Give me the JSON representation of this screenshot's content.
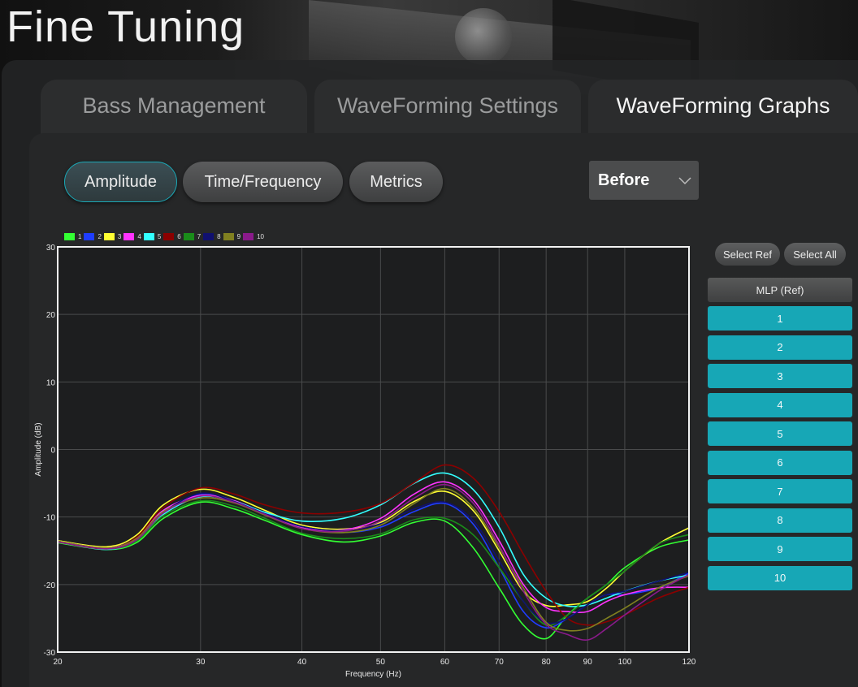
{
  "page_title": "Fine Tuning",
  "tabs": [
    {
      "label": "Bass Management",
      "active": false
    },
    {
      "label": "WaveForming Settings",
      "active": false
    },
    {
      "label": "WaveForming Graphs",
      "active": true
    }
  ],
  "view_buttons": [
    {
      "label": "Amplitude",
      "active": true
    },
    {
      "label": "Time/Frequency",
      "active": false
    },
    {
      "label": "Metrics",
      "active": false
    }
  ],
  "view_select": {
    "value": "Before"
  },
  "side_panel": {
    "select_ref_label": "Select Ref",
    "select_all_label": "Select All",
    "ref_label": "MLP (Ref)",
    "mics": [
      "1",
      "2",
      "3",
      "4",
      "5",
      "6",
      "7",
      "8",
      "9",
      "10"
    ]
  },
  "colors": {
    "accent": "#17a7b6"
  },
  "chart_data": {
    "type": "line",
    "xlabel": "Frequency (Hz)",
    "ylabel": "Amplitude (dB)",
    "x_scale": "log",
    "xlim": [
      20,
      120
    ],
    "ylim": [
      -30,
      30
    ],
    "x_ticks": [
      20,
      30,
      40,
      50,
      60,
      70,
      80,
      90,
      100,
      120
    ],
    "y_ticks": [
      30,
      20,
      10,
      0,
      -10,
      -20,
      -30
    ],
    "grid": true,
    "legend_position": "top-left",
    "x": [
      20,
      23,
      25,
      27,
      30,
      33,
      36,
      40,
      45,
      50,
      55,
      60,
      65,
      70,
      75,
      80,
      85,
      90,
      95,
      100,
      110,
      120
    ],
    "series": [
      {
        "name": "1",
        "color": "#33ff33",
        "values": [
          -13.8,
          -14.8,
          -13.8,
          -10.2,
          -7.8,
          -8.8,
          -10.5,
          -12.6,
          -13.7,
          -12.8,
          -10.8,
          -10.6,
          -14.5,
          -20.5,
          -26.0,
          -28.0,
          -24.5,
          -22.0,
          -20.0,
          -17.5,
          -14.5,
          -13.4
        ]
      },
      {
        "name": "2",
        "color": "#1f3dff",
        "values": [
          -13.6,
          -14.6,
          -13.3,
          -9.3,
          -6.6,
          -7.6,
          -9.4,
          -11.6,
          -12.3,
          -11.5,
          -9.2,
          -8.0,
          -11.0,
          -17.5,
          -24.0,
          -26.4,
          -25.0,
          -23.0,
          -21.5,
          -21.5,
          -20.5,
          -18.3
        ]
      },
      {
        "name": "3",
        "color": "#ffff33",
        "values": [
          -13.5,
          -14.4,
          -12.7,
          -8.2,
          -5.9,
          -7.1,
          -9.0,
          -11.2,
          -11.8,
          -10.8,
          -7.7,
          -6.2,
          -9.0,
          -15.0,
          -21.0,
          -23.1,
          -23.0,
          -22.5,
          -20.5,
          -18.0,
          -14.0,
          -11.6
        ]
      },
      {
        "name": "4",
        "color": "#ff33ff",
        "values": [
          -13.6,
          -14.6,
          -13.1,
          -9.0,
          -6.8,
          -7.6,
          -9.5,
          -11.6,
          -11.9,
          -10.2,
          -6.6,
          -4.8,
          -7.4,
          -13.5,
          -20.0,
          -23.4,
          -24.0,
          -24.0,
          -22.5,
          -21.5,
          -20.5,
          -20.4
        ]
      },
      {
        "name": "5",
        "color": "#33ffff",
        "values": [
          -13.7,
          -14.8,
          -13.5,
          -9.6,
          -7.0,
          -7.7,
          -9.3,
          -10.6,
          -10.2,
          -8.2,
          -5.0,
          -3.5,
          -5.9,
          -11.5,
          -18.5,
          -22.0,
          -23.2,
          -23.0,
          -22.0,
          -21.0,
          -19.5,
          -18.6
        ]
      },
      {
        "name": "6",
        "color": "#8b0000",
        "values": [
          -13.7,
          -14.7,
          -13.0,
          -8.6,
          -5.7,
          -6.6,
          -8.2,
          -9.4,
          -9.3,
          -8.0,
          -4.9,
          -2.3,
          -4.2,
          -9.2,
          -15.5,
          -21.0,
          -25.0,
          -26.0,
          -25.5,
          -24.5,
          -22.0,
          -20.4
        ]
      },
      {
        "name": "7",
        "color": "#1a8c1a",
        "values": [
          -13.6,
          -14.7,
          -13.6,
          -9.8,
          -7.6,
          -8.4,
          -10.2,
          -12.4,
          -13.2,
          -12.5,
          -10.4,
          -10.2,
          -12.6,
          -17.5,
          -22.5,
          -26.0,
          -24.5,
          -22.0,
          -20.0,
          -18.0,
          -14.0,
          -12.6
        ]
      },
      {
        "name": "8",
        "color": "#101070",
        "values": [
          -13.6,
          -14.6,
          -13.3,
          -9.3,
          -6.5,
          -7.7,
          -9.5,
          -11.4,
          -12.0,
          -11.0,
          -8.8,
          -7.8,
          -10.5,
          -16.5,
          -22.5,
          -25.6,
          -25.0,
          -23.0,
          -21.5,
          -21.0,
          -19.5,
          -18.2
        ]
      },
      {
        "name": "9",
        "color": "#808020",
        "values": [
          -13.6,
          -14.6,
          -13.2,
          -9.2,
          -7.2,
          -7.9,
          -9.7,
          -11.7,
          -12.3,
          -11.2,
          -8.0,
          -5.8,
          -8.6,
          -14.5,
          -20.5,
          -25.6,
          -26.8,
          -26.5,
          -25.0,
          -23.5,
          -20.5,
          -18.7
        ]
      },
      {
        "name": "10",
        "color": "#8a1a8a",
        "values": [
          -13.7,
          -14.7,
          -13.4,
          -9.4,
          -6.9,
          -7.8,
          -9.6,
          -11.7,
          -12.1,
          -10.6,
          -7.2,
          -5.2,
          -7.9,
          -14.2,
          -21.0,
          -25.9,
          -27.4,
          -28.2,
          -26.5,
          -24.5,
          -21.0,
          -18.5
        ]
      }
    ]
  }
}
